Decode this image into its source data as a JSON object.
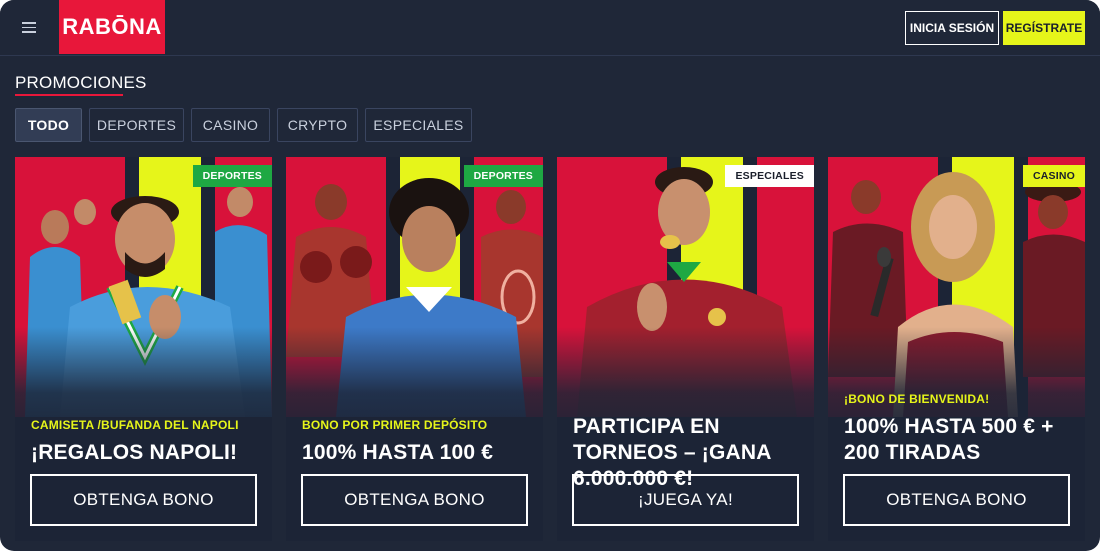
{
  "header": {
    "logo": "RABŌNA",
    "login_label": "INICIA SESIÓN",
    "register_label": "REGÍSTRATE"
  },
  "page": {
    "title": "PROMOCIONES"
  },
  "tabs": [
    {
      "label": "TODO",
      "active": true
    },
    {
      "label": "DEPORTES",
      "active": false
    },
    {
      "label": "CASINO",
      "active": false
    },
    {
      "label": "CRYPTO",
      "active": false
    },
    {
      "label": "ESPECIALES",
      "active": false
    }
  ],
  "cards": [
    {
      "badge": "DEPORTES",
      "subtitle": "CAMISETA /BUFANDA DEL NAPOLI",
      "headline": "¡REGALOS NAPOLI!",
      "button": "OBTENGA BONO"
    },
    {
      "badge": "DEPORTES",
      "subtitle": "BONO POR PRIMER DEPÓSITO",
      "headline": "100% HASTA 100 €",
      "button": "OBTENGA BONO"
    },
    {
      "badge": "ESPECIALES",
      "subtitle": "",
      "headline": "PARTICIPA EN TORNEOS – ¡GANA 6.000.000 €!",
      "button": "¡JUEGA YA!"
    },
    {
      "badge": "CASINO",
      "subtitle": "¡BONO DE BIENVENIDA!",
      "headline": "100% HASTA 500 € + 200 TIRADAS",
      "button": "OBTENGA BONO"
    }
  ],
  "colors": {
    "background": "#1f2738",
    "brand_red": "#e8173a",
    "accent_yellow": "#e6f51a",
    "badge_green": "#1ea843"
  }
}
